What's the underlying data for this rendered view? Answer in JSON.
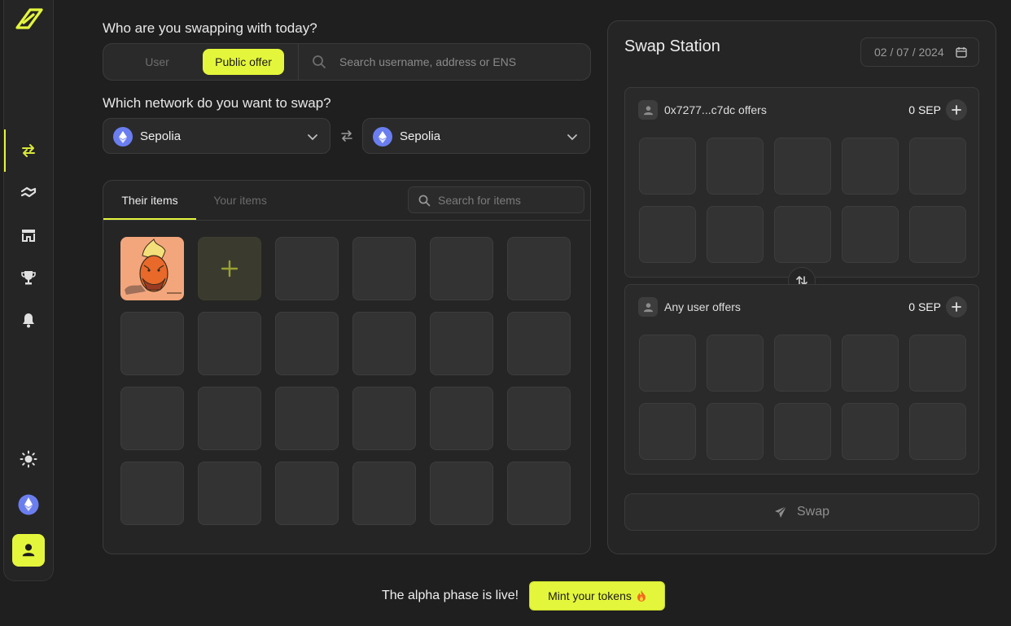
{
  "colors": {
    "accent": "#e4f63b",
    "background": "#1f1f1f",
    "panel": "#252525",
    "eth": "#6b7ef0"
  },
  "sidebar": {
    "items": [
      {
        "icon": "swap-arrows-icon",
        "active": true
      },
      {
        "icon": "handshake-swap-icon",
        "active": false
      },
      {
        "icon": "store-icon",
        "active": false
      },
      {
        "icon": "trophy-icon",
        "active": false
      },
      {
        "icon": "bell-icon",
        "active": false
      }
    ],
    "bottom": [
      "sun-icon",
      "ethereum-icon",
      "user-icon"
    ]
  },
  "swap_with": {
    "question": "Who are you swapping with today?",
    "option_user": "User",
    "option_public": "Public offer",
    "search_placeholder": "Search username, address or ENS"
  },
  "network": {
    "question": "Which network do you want to swap?",
    "from": "Sepolia",
    "to": "Sepolia"
  },
  "items": {
    "tab_their": "Their items",
    "tab_your": "Your items",
    "search_placeholder": "Search for items"
  },
  "station": {
    "title": "Swap Station",
    "date": "02 / 07 / 2024",
    "offer_top": {
      "title": "0x7277...c7dc offers",
      "amount": "0 SEP"
    },
    "offer_bottom": {
      "title": "Any user offers",
      "amount": "0 SEP"
    },
    "swap_label": "Swap"
  },
  "footer": {
    "text": "The alpha phase is live!",
    "button": "Mint your tokens"
  }
}
